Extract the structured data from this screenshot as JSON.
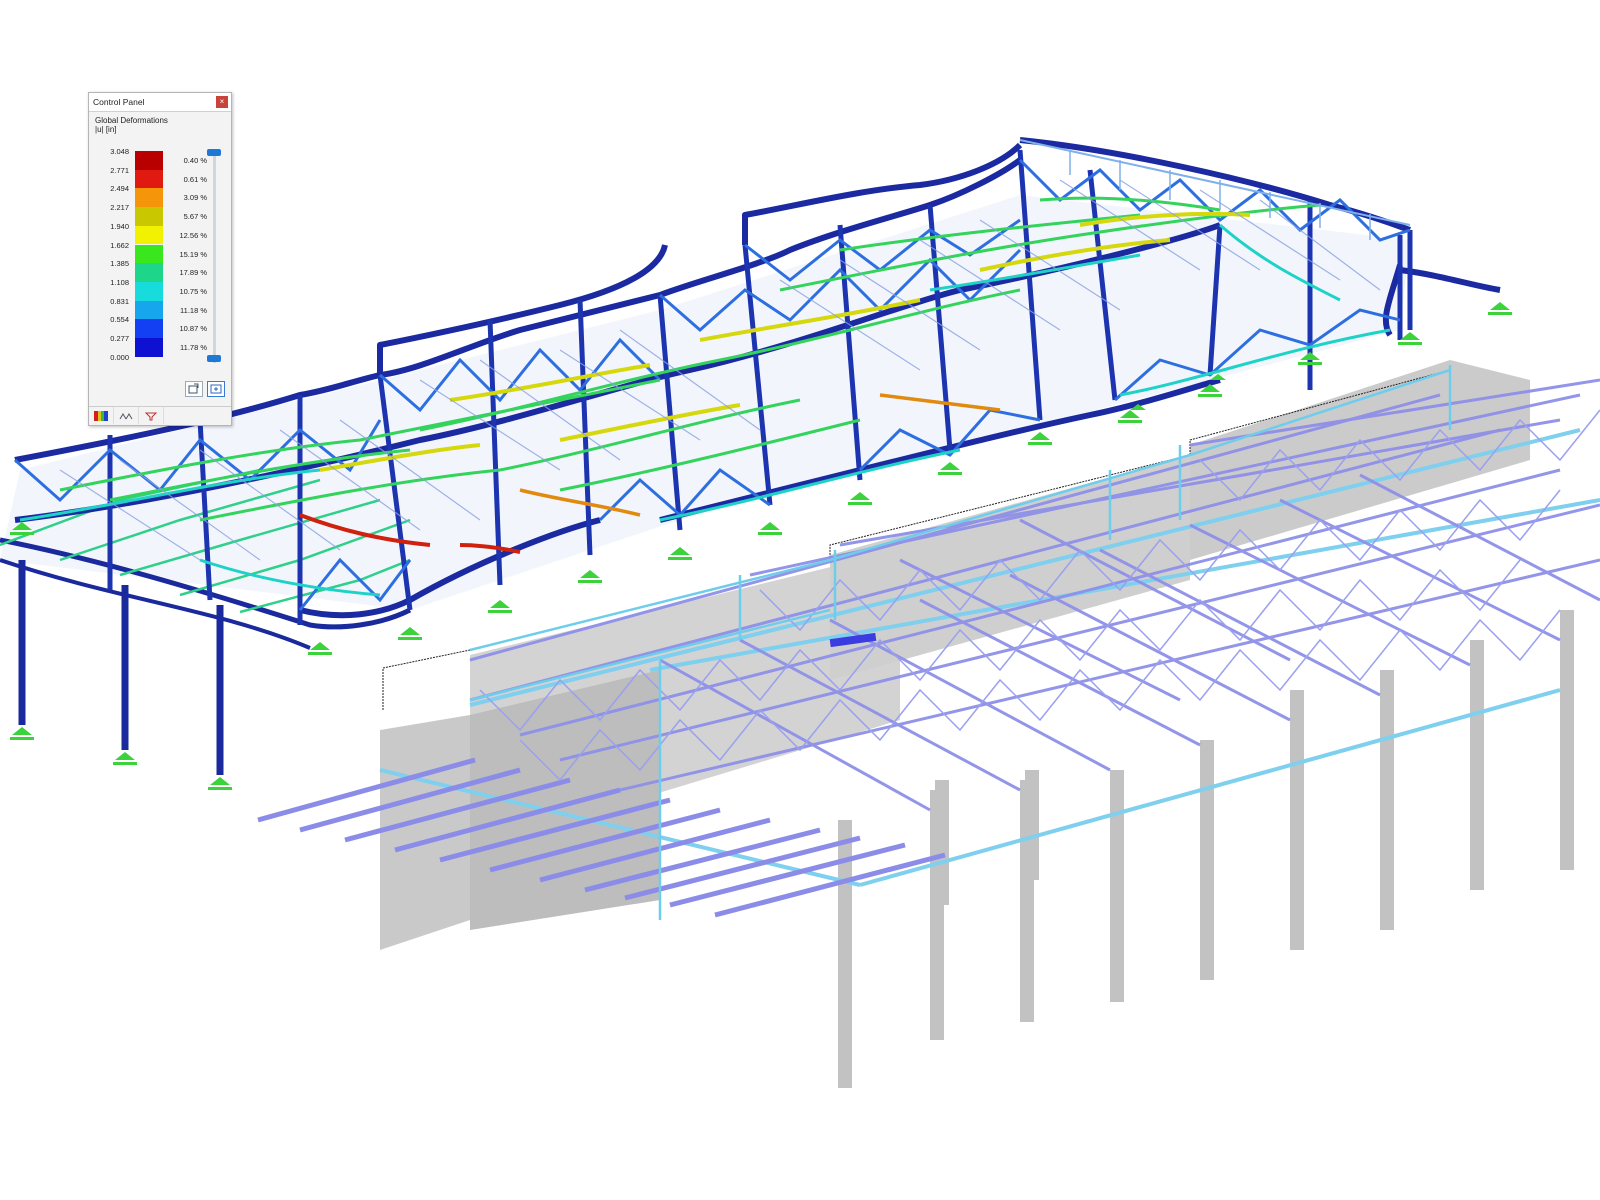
{
  "control_panel": {
    "title": "Control Panel",
    "close_label": "×",
    "result_title": "Global Deformations",
    "result_unit": "|u| [in]",
    "legend": [
      {
        "value": "3.048",
        "color": "#b80000",
        "percent": "0.40 %"
      },
      {
        "value": "2.771",
        "color": "#e01a10",
        "percent": "0.61 %"
      },
      {
        "value": "2.494",
        "color": "#f5960a",
        "percent": "3.09 %"
      },
      {
        "value": "2.217",
        "color": "#c9c800",
        "percent": "5.67 %"
      },
      {
        "value": "1.940",
        "color": "#f2f200",
        "percent": "12.56 %"
      },
      {
        "value": "1.662",
        "color": "#3ae61c",
        "percent": "15.19 %"
      },
      {
        "value": "1.385",
        "color": "#1ed68a",
        "percent": "17.89 %"
      },
      {
        "value": "1.108",
        "color": "#18dcdc",
        "percent": "10.75 %"
      },
      {
        "value": "0.831",
        "color": "#16a6ee",
        "percent": "11.18 %"
      },
      {
        "value": "0.554",
        "color": "#1240f2",
        "percent": "10.87 %"
      },
      {
        "value": "0.277",
        "color": "#0e10d2",
        "percent": "11.78 %"
      },
      {
        "value": "0.000",
        "color": null,
        "percent": null
      }
    ],
    "tabs": [
      "color-scale-icon",
      "balance-icon",
      "filter-icon"
    ]
  },
  "colors": {
    "frame_dark": "#1a2a9c",
    "frame_blue": "#2a5fd0",
    "frame_cyan": "#22c8dc",
    "frame_green": "#2fd060",
    "frame_yellow": "#d8e010",
    "frame_red": "#d02010",
    "support": "#3cd23c",
    "model_violet": "#8c8ee6",
    "model_light": "#7fd0ee",
    "concrete": "#c7c7c7"
  }
}
